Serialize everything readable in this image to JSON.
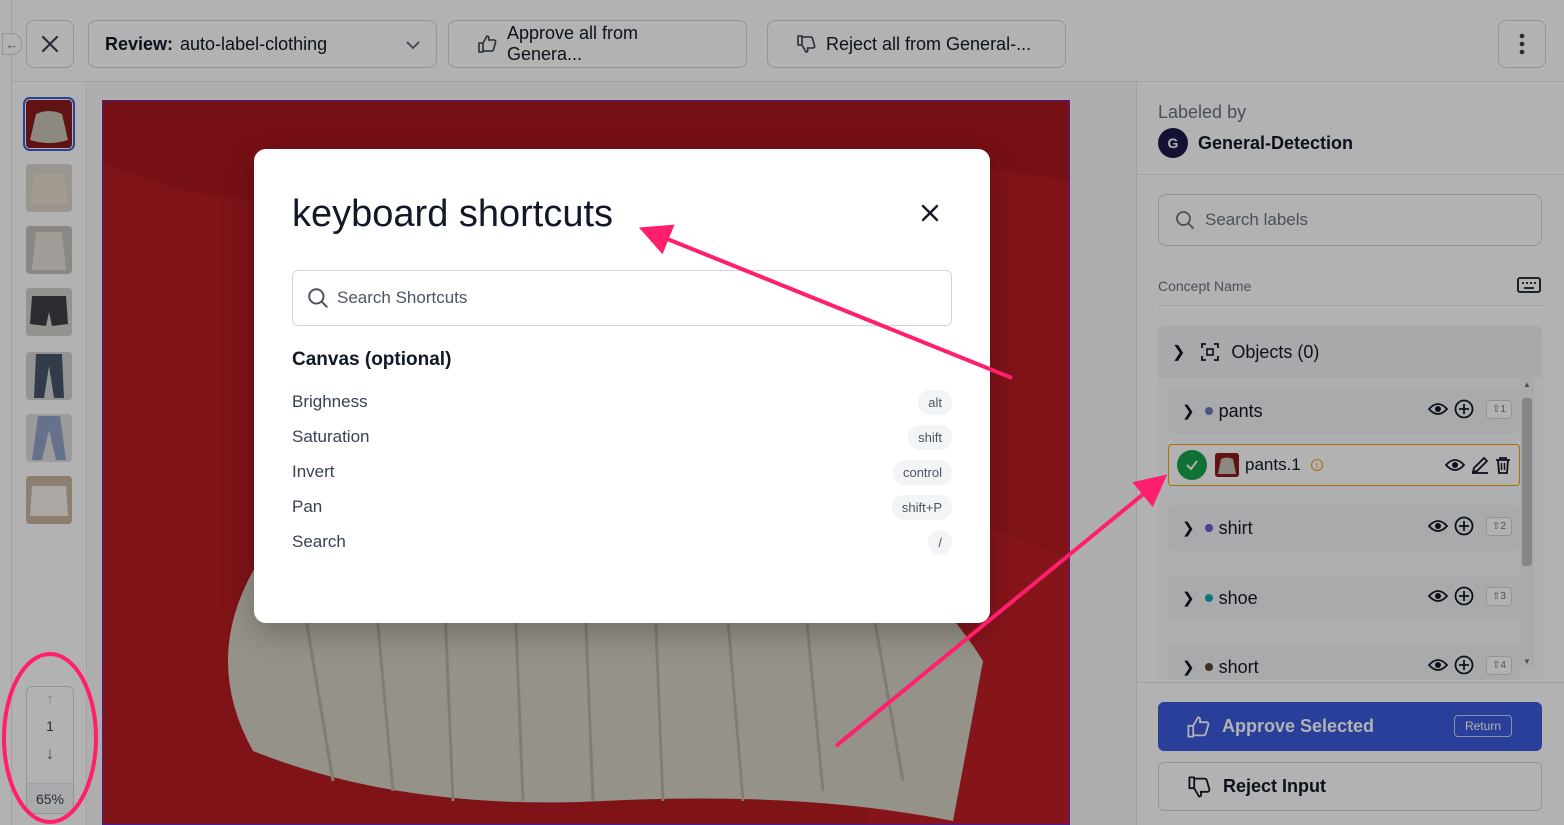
{
  "topbar": {
    "close_icon": "close-icon",
    "review_label": "Review:",
    "review_value": "auto-label-clothing",
    "approve_all": "Approve all from Genera...",
    "reject_all": "Reject all from General-..."
  },
  "pager": {
    "current": "1",
    "zoom": "65%"
  },
  "panel": {
    "labeled_by": "Labeled by",
    "avatar_initial": "G",
    "labeler": "General-Detection",
    "search_placeholder": "Search labels",
    "concept_header": "Concept Name",
    "objects": "Objects (0)",
    "labels": [
      {
        "name": "pants",
        "color": "#6b7db3",
        "hotkey": "⇧1"
      },
      {
        "name": "shirt",
        "color": "#6d5bd0",
        "hotkey": "⇧2"
      },
      {
        "name": "shoe",
        "color": "#17a2b8",
        "hotkey": "⇧3"
      },
      {
        "name": "short",
        "color": "#5b4636",
        "hotkey": "⇧4"
      }
    ],
    "instance": "pants.1",
    "approve_selected": "Approve Selected",
    "approve_key": "Return",
    "reject_input": "Reject Input"
  },
  "modal": {
    "title": "keyboard shortcuts",
    "search_placeholder": "Search Shortcuts",
    "section": "Canvas (optional)",
    "shortcuts": [
      {
        "name": "Brighness",
        "key": "alt"
      },
      {
        "name": "Saturation",
        "key": "shift"
      },
      {
        "name": "Invert",
        "key": "control"
      },
      {
        "name": "Pan",
        "key": "shift+P"
      },
      {
        "name": "Search",
        "key": "/"
      }
    ]
  },
  "colors": {
    "accent": "#3b5bdb",
    "annotation": "#ff1f6d",
    "check": "#16a34a",
    "highlight_border": "#f59e0b"
  }
}
